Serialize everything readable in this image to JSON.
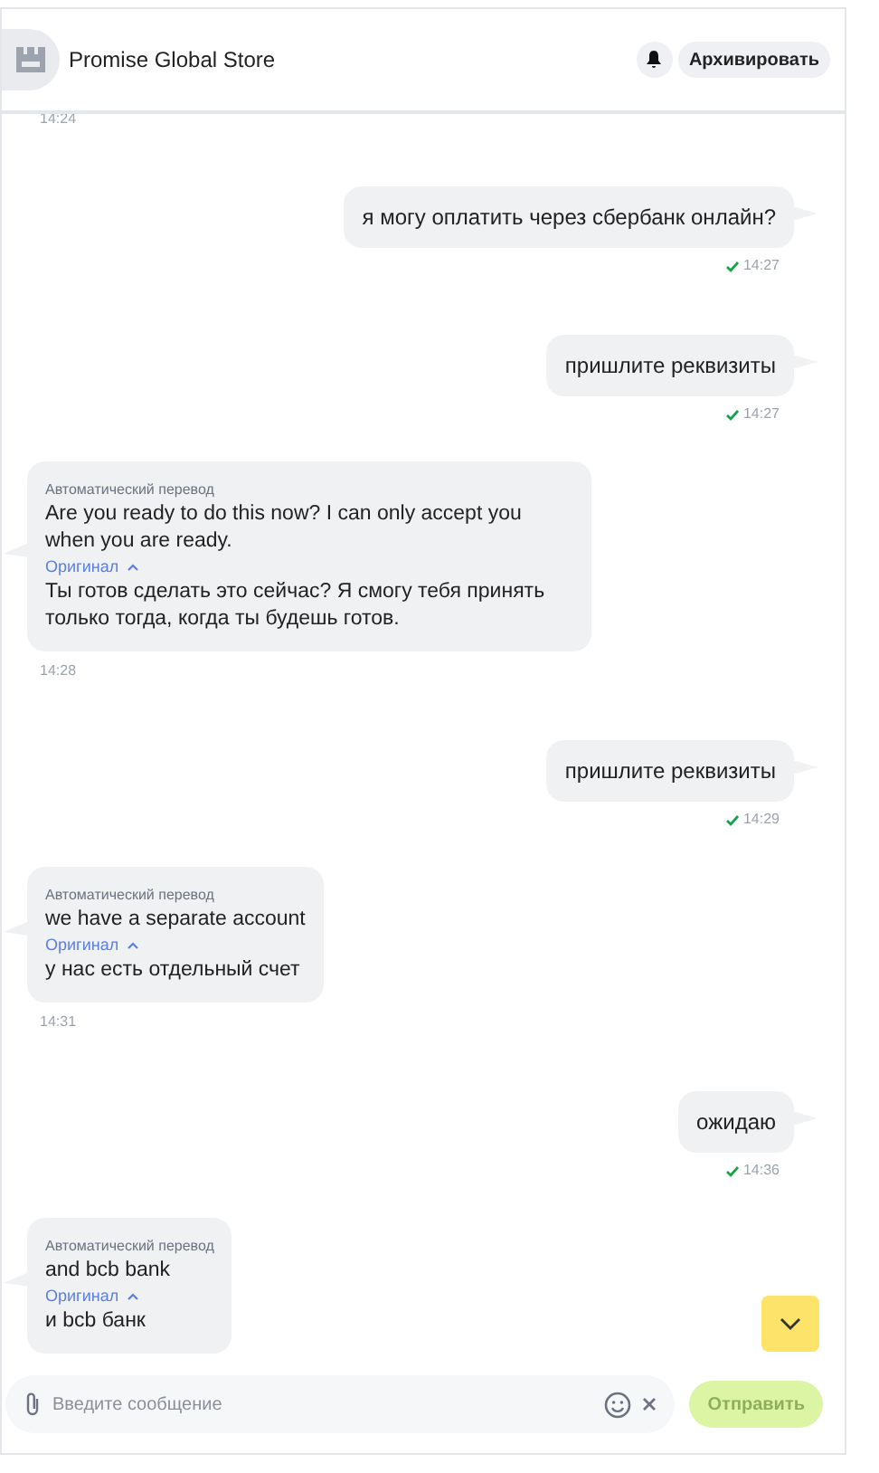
{
  "header": {
    "title": "Promise Global Store",
    "archive_button": "Архивировать"
  },
  "messages": [
    {
      "kind": "time",
      "time": "14:24"
    },
    {
      "kind": "outgoing",
      "text": "я могу оплатить через сбербанк онлайн?",
      "time": "14:27",
      "read": true
    },
    {
      "kind": "outgoing",
      "text": "пришлите реквизиты",
      "time": "14:27",
      "read": true
    },
    {
      "kind": "incoming",
      "label": "Автоматический перевод",
      "translation": "Are you ready to do this now? I can only accept you when you are ready.",
      "original_link": "Оригинал",
      "original": "Ты готов сделать это сейчас? Я смогу тебя принять только тогда, когда ты будешь готов.",
      "time": "14:28"
    },
    {
      "kind": "outgoing",
      "text": "пришлите реквизиты",
      "time": "14:29",
      "read": true
    },
    {
      "kind": "incoming",
      "label": "Автоматический перевод",
      "translation": "we have a separate account",
      "original_link": "Оригинал",
      "original": "у нас есть отдельный счет",
      "time": "14:31"
    },
    {
      "kind": "outgoing",
      "text": "ожидаю",
      "time": "14:36",
      "read": true
    },
    {
      "kind": "incoming",
      "label": "Автоматический перевод",
      "translation": "and bcb bank",
      "original_link": "Оригинал",
      "original": "и bcb банк"
    }
  ],
  "composer": {
    "placeholder": "Введите сообщение",
    "send_button": "Отправить",
    "send_disabled": true
  }
}
